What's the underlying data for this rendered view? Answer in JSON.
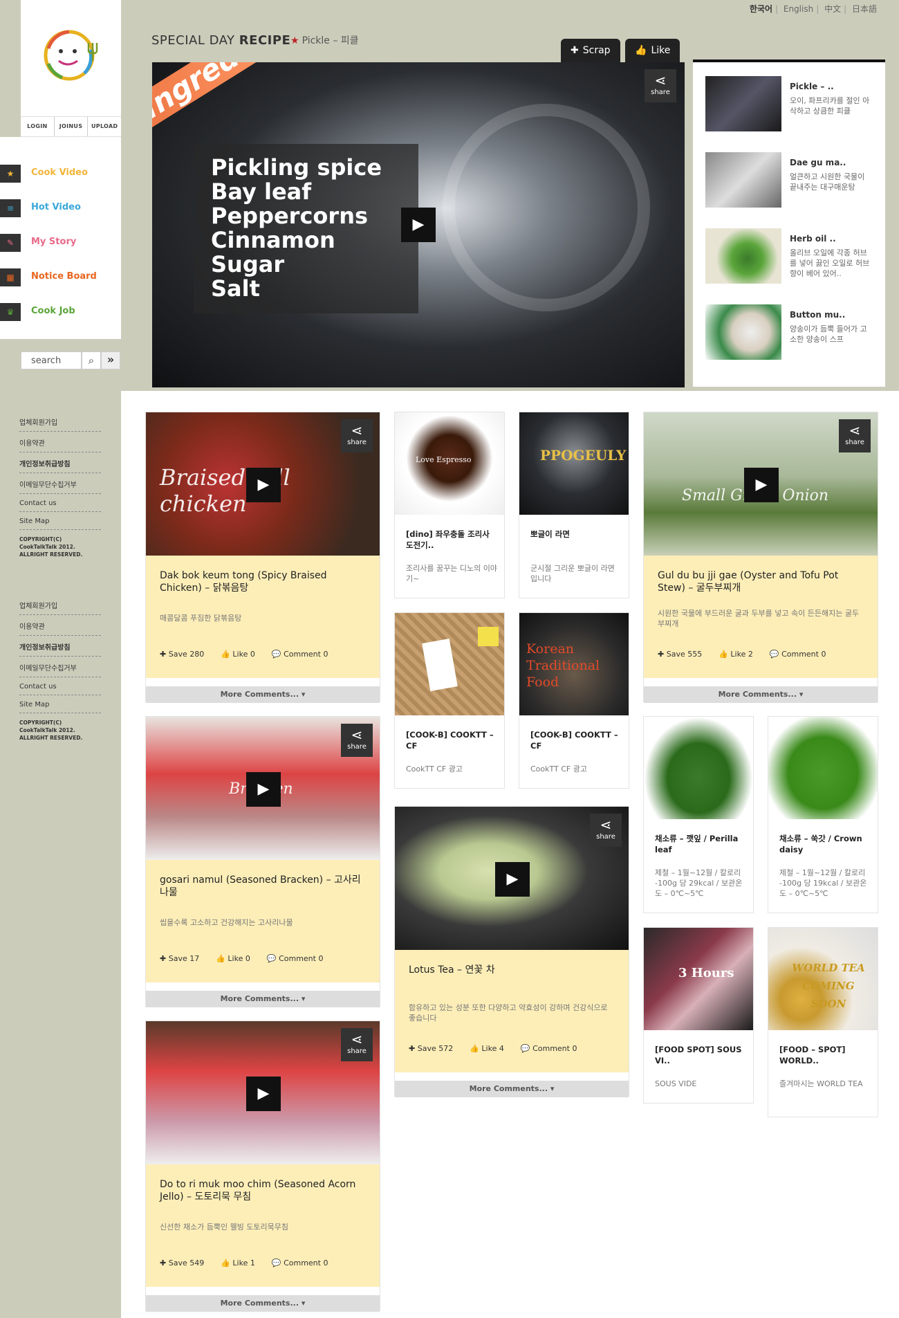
{
  "languages": [
    {
      "label": "한국어",
      "current": true
    },
    {
      "label": "English"
    },
    {
      "label": "中文"
    },
    {
      "label": "日本語"
    }
  ],
  "auth": {
    "login": "LOGIN",
    "joinus": "JOINUS",
    "upload": "UPLOAD"
  },
  "nav": [
    {
      "label": "Cook Video",
      "color": "#f2b53a",
      "icon": "star-icon",
      "glyph": "★"
    },
    {
      "label": "Hot Video",
      "color": "#3aa9d8",
      "icon": "list-icon",
      "glyph": "≡"
    },
    {
      "label": "My Story",
      "color": "#e86a8a",
      "icon": "pencil-icon",
      "glyph": "✎"
    },
    {
      "label": "Notice Board",
      "color": "#e8661f",
      "icon": "board-icon",
      "glyph": "▦"
    },
    {
      "label": "Cook Job",
      "color": "#5aa53a",
      "icon": "chef-icon",
      "glyph": "♛"
    }
  ],
  "search": {
    "placeholder": "search"
  },
  "special": {
    "title_light": "SPECIAL DAY ",
    "title_bold": "RECIPE",
    "subtitle": "Pickle – 피클",
    "scrap": "Scrap",
    "like": "Like",
    "banner": "Ingredients",
    "ingredients": [
      "Pickling spice",
      "Bay leaf",
      "Peppercorns",
      "Cinnamon",
      "Sugar",
      "Salt"
    ],
    "share": "share"
  },
  "sidelist": [
    {
      "title": "Pickle – ..",
      "desc": "오이, 파프리카를 절인 아삭하고 상큼한 피클"
    },
    {
      "title": "Dae gu ma..",
      "desc": "얼큰하고 시원한 국물이 끝내주는 대구매운탕"
    },
    {
      "title": "Herb oil ..",
      "desc": "올리브 오일에 각종 허브를 넣어 끓인 오일로 허브 향이 베어 있어.."
    },
    {
      "title": "Button mu..",
      "desc": "양송이가 듬뿍 들어가 고소한 양송이 스프"
    }
  ],
  "footer": {
    "links": [
      "업체회원가입",
      "이용약관",
      "개인정보취급방침",
      "이메일무단수집거부",
      "Contact us",
      "Site Map"
    ],
    "copyright": [
      "COPYRIGHT(C)",
      "CookTalkTalk 2012.",
      "ALLRIGHT RESERVED."
    ]
  },
  "cards_big": [
    {
      "title": "Dak bok keum tong (Spicy Braised Chicken) – 닭볶음탕",
      "desc": "매콤달콤 푸짐한 닭볶음탕",
      "save": "Save 280",
      "like": "Like 0",
      "comment": "Comment 0",
      "more": "More Comments...",
      "overlay": "Braised Kill chicken"
    },
    {
      "title": "gosari namul (Seasoned Bracken) – 고사리나물",
      "desc": "씹을수록 고소하고 건강해지는 고사리나물",
      "save": "Save 17",
      "like": "Like 0",
      "comment": "Comment 0",
      "more": "More Comments...",
      "overlay": "Bracken"
    },
    {
      "title": "Do to ri muk moo chim (Seasoned Acorn Jello) – 도토리묵 무침",
      "desc": "신선한 채소가 듬뿍인 웰빙 도토리묵무침",
      "save": "Save 549",
      "like": "Like 1",
      "comment": "Comment 0",
      "more": "More Comments..."
    },
    {
      "title": "Gul du bu jji gae (Oyster and Tofu Pot Stew) – 굴두부찌개",
      "desc": "시원한 국물에 부드러운 굴과 두부를 넣고 속이 든든해지는 굴두부찌개",
      "save": "Save 555",
      "like": "Like 2",
      "comment": "Comment 0",
      "more": "More Comments...",
      "overlay": "Small Green Onion"
    },
    {
      "title": "Lotus Tea – 연꽃 차",
      "desc": "함유하고 있는 성분 또한 다양하고 약효성이 강하며 건강식으로 좋습니다",
      "save": "Save 572",
      "like": "Like 4",
      "comment": "Comment 0",
      "more": "More Comments..."
    }
  ],
  "cards_small": [
    {
      "title": "[dino] 좌우충돌 조리사 도전기..",
      "desc": "조리사를 꿈꾸는 디노의 이야기~",
      "overlay": "Love Espresso"
    },
    {
      "title": "뽀글이 라면",
      "desc": "군시절 그리운 뽀글이 라면 입니다",
      "overlay": "PPOGEULY"
    },
    {
      "title": "[COOK-B] COOKTT – CF",
      "desc": "CookTT CF 광고"
    },
    {
      "title": "[COOK-B] COOKTT – CF",
      "desc": "CookTT CF 광고",
      "overlay": "Korean Traditional Food"
    },
    {
      "title": "채소류 – 깻잎 / Perilla leaf",
      "desc": "제철 – 1월~12월 / 칼로리 -100g 당 29kcal / 보관온도 – 0℃~5℃"
    },
    {
      "title": "채소류 – 쑥갓 / Crown daisy",
      "desc": "제철 – 1월~12월 / 칼로리 -100g 당 19kcal / 보관온도 – 0℃~5℃"
    },
    {
      "title": "[FOOD SPOT] SOUS VI..",
      "desc": "SOUS VIDE",
      "overlay": "3 Hours"
    },
    {
      "title": "[FOOD – SPOT] WORLD..",
      "desc": "즐겨마시는 WORLD TEA",
      "overlay": "WORLD TEA COMING SOON"
    }
  ]
}
